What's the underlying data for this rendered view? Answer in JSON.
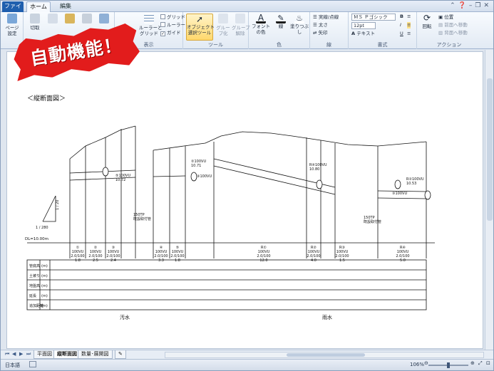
{
  "tabs": {
    "file": "ファイル",
    "home": "ホーム",
    "edit": "編集"
  },
  "ribbon": {
    "page_setup": "ページ\n設定",
    "cut": "切取",
    "grid_options": {
      "grid": "グリッド",
      "ruler": "ルーラー",
      "guide": "ガイド"
    },
    "ruler_grid_btn": "ルーラーと\nグリッド",
    "object_tool": "オブジェクト\n選択ツール",
    "group": "グループ化",
    "ungroup": "グループ\n解除",
    "font_color": "フォントの色",
    "line": "線",
    "fill": "塗りつぶし",
    "line_style_1": "実線/点線",
    "line_style_2": "太さ",
    "line_style_3": "矢印",
    "font_name": "ＭＳ Ｐゴシック",
    "font_size": "12pt",
    "text_btn": "テキスト",
    "rotate": "回転",
    "position": "位置",
    "bring_front": "前面へ移動",
    "send_back": "背面へ移動",
    "group_labels": {
      "display": "表示",
      "tools": "ツール",
      "color": "色",
      "line": "線",
      "style": "書式",
      "action": "アクション"
    }
  },
  "badge": "自動機能！",
  "drawing": {
    "heading": "＜縦断面図＞",
    "sewage_label": "汚水",
    "rain_label": "雨水",
    "dl_label": "DL=10.00m",
    "slope_labels": [
      "1 / 20",
      "1 / 280"
    ],
    "pipe_notes": [
      "150TP\n既設取付管",
      "150TP\n既設取付管"
    ],
    "manholes": [
      {
        "id": "①",
        "spec": "100VU\n2.0/100",
        "len": "1.8"
      },
      {
        "id": "②",
        "spec": "100VU\n2.0/100",
        "len": "2.5"
      },
      {
        "id": "③",
        "spec": "100VU\n2.0/100",
        "len": "2.4"
      },
      {
        "id": "④",
        "spec": "100VU\n2.0/100",
        "len": "3.3"
      },
      {
        "id": "⑤",
        "spec": "100VU\n2.0/100",
        "len": "1.8"
      },
      {
        "id": "R①",
        "spec": "100VU\n2.0/100",
        "len": "12.0"
      },
      {
        "id": "R②",
        "spec": "100VU\n2.0/100",
        "len": "4.0"
      },
      {
        "id": "R③",
        "spec": "100VU\n2.0/100",
        "len": "1.5"
      },
      {
        "id": "R④",
        "spec": "100VU\n2.0/100",
        "len": "5.0"
      }
    ],
    "callouts": [
      "⑤100VU\n10.72",
      "②100VU\n10.71",
      "③100VU",
      "R④100VU\n10.80",
      "R②100VU\n10.53",
      "③100VU"
    ],
    "row_headers": [
      "管底高",
      "土被り",
      "地盤高",
      "延長",
      "追加距離"
    ],
    "unit": "(m)"
  },
  "sheets": {
    "tab1": "平面図",
    "tab2": "縦断面図",
    "tab3": "数量･展開図"
  },
  "status": {
    "language": "日本語",
    "zoom": "106%"
  }
}
